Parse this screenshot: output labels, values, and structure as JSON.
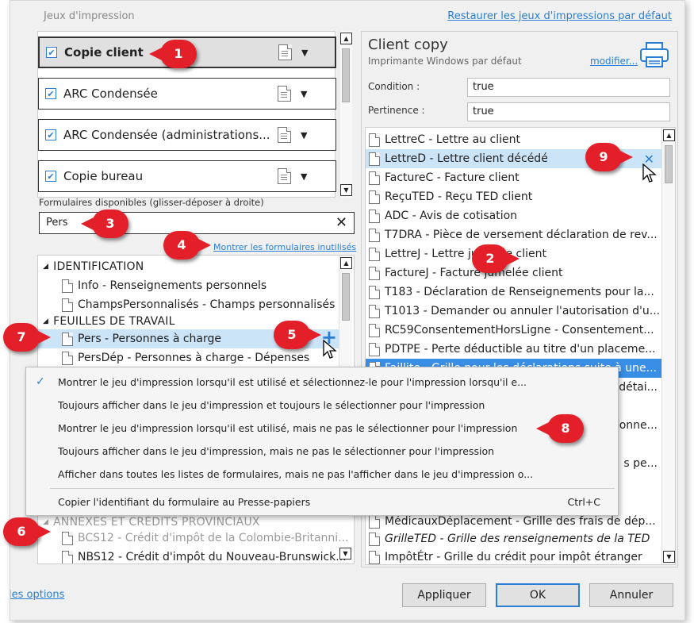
{
  "dialog": {
    "title": "Jeux d'impression",
    "restore_link": "Restaurer les jeux d'impressions par défaut"
  },
  "print_sets": [
    {
      "label": "Copie client",
      "checked": true,
      "selected": true
    },
    {
      "label": "ARC Condensée",
      "checked": true,
      "selected": false
    },
    {
      "label": "ARC Condensée (administrations...",
      "checked": true,
      "selected": false
    },
    {
      "label": "Copie bureau",
      "checked": true,
      "selected": false
    }
  ],
  "forms": {
    "label": "Formulaires disponibles (glisser-déposer à droite)",
    "search_value": "Pers",
    "show_unused_link": "Montrer les formulaires inutilisés",
    "groups_top": [
      {
        "name": "IDENTIFICATION",
        "items": [
          "Info - Renseignements personnels",
          "ChampsPersonnalisés - Champs personnalisés"
        ]
      },
      {
        "name": "FEUILLES DE TRAVAIL",
        "items": [
          "Pers - Personnes à charge",
          "PersDép - Personnes à charge - Dépenses"
        ]
      }
    ],
    "groups_bottom": [
      {
        "name": "ANNEXES ET CRÉDITS PROVINCIAUX",
        "items": [
          "BCS12 - Crédit d'impôt de la Colombie-Britanni...",
          "NBS12 - Crédit d'impôt du Nouveau-Brunswick..."
        ]
      }
    ]
  },
  "context_menu": {
    "items": [
      {
        "label": "Montrer le jeu d'impression lorsqu'il est utilisé et sélectionnez-le pour l'impression lorsqu'il e...",
        "checked": true
      },
      {
        "label": "Toujours afficher dans le jeu d'impression et toujours le sélectionner pour l'impression",
        "checked": false
      },
      {
        "label": "Montrer le jeu d'impression lorsqu'il est utilisé, mais ne pas le sélectionner pour l'impression",
        "checked": false
      },
      {
        "label": "Toujours afficher dans le jeu d'impression, mais ne pas le sélectionner pour l'impression",
        "checked": false
      },
      {
        "label": "Afficher dans toutes les listes de formulaires, mais ne pas l'afficher dans le jeu d'impression o...",
        "checked": false
      }
    ],
    "copy_item": "Copier l'identifiant du formulaire au Presse-papiers",
    "copy_shortcut": "Ctrl+C"
  },
  "right_panel": {
    "title": "Client copy",
    "subtitle": "Imprimante Windows par défaut",
    "modify_link": "modifier...",
    "condition_label": "Condition :",
    "condition_value": "true",
    "pertinence_label": "Pertinence :",
    "pertinence_value": "true",
    "forms": [
      "LettreC - Lettre au client",
      "LettreD - Lettre client décédé",
      "FactureC - Facture client",
      "ReçuTED - Reçu TED client",
      "ADC - Avis de cotisation",
      "T7DRA - Pièce de versement déclaration de rev...",
      "LettreJ - Lettre jumelée client",
      "FactureJ - Facture jumelée client",
      "T183 - Déclaration de Renseignements pour la...",
      "T1013 - Demander ou annuler l'autorisation d'u...",
      "RC59ConsentementHorsLigne - Consentement...",
      "PDTPE - Perte déductible au titre d'un placeme...",
      "Faillite - Grille pour les déclarations suite à une...",
      "détai...",
      "onne...",
      "s pe...",
      "MédicauxDéplacement - Grille des frais de dép...",
      "GrilleTED - Grille des renseignements de la TED",
      "ImpôtÉtr - Grille du crédit pour impôt étranger"
    ]
  },
  "footer": {
    "options_link": "les options",
    "apply": "Appliquer",
    "ok": "OK",
    "cancel": "Annuler"
  },
  "callouts": [
    "1",
    "2",
    "3",
    "4",
    "5",
    "6",
    "7",
    "8",
    "9"
  ],
  "colors": {
    "accent": "#2a7fd4",
    "selection": "#cce4f7",
    "highlight": "#3a8ee6",
    "callout": "#e3202a"
  }
}
